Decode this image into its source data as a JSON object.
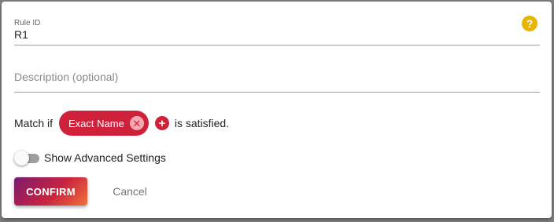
{
  "rule_id": {
    "label": "Rule ID",
    "value": "R1"
  },
  "description": {
    "placeholder": "Description (optional)",
    "value": ""
  },
  "help": {
    "icon": "help-icon",
    "glyph": "?",
    "color": "#e8b400"
  },
  "match": {
    "prefix": "Match if",
    "chips": [
      {
        "label": "Exact Name",
        "remove_glyph": "✕"
      }
    ],
    "add_glyph": "+",
    "suffix": "is satisfied.",
    "accent_color": "#d0213a"
  },
  "advanced": {
    "toggle_label": "Show Advanced Settings",
    "enabled": false
  },
  "actions": {
    "confirm_label": "CONFIRM",
    "cancel_label": "Cancel"
  }
}
